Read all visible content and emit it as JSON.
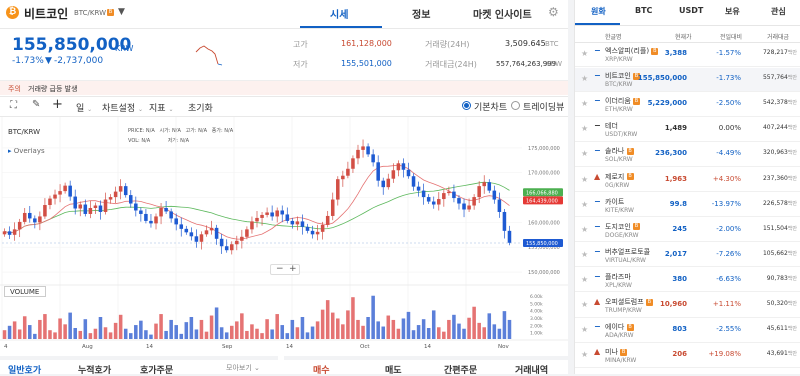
{
  "header": {
    "coin_name": "비트코인",
    "coin_pair": "BTC/KRW",
    "badge": "B",
    "tabs": [
      "시세",
      "정보",
      "마켓 인사이트"
    ],
    "active_tab": "시세"
  },
  "price": {
    "current": "155,850,000",
    "unit": "KRW",
    "change_pct": "-1.73%",
    "change_arrow": "▼",
    "change_amount": "-2,737,000",
    "high_label": "고가",
    "high": "161,128,000",
    "low_label": "저가",
    "low": "155,501,000",
    "vol_label": "거래량(24H)",
    "vol": "3,509.645",
    "vol_unit": "BTC",
    "amount_label": "거래대금(24H)",
    "amount": "557,764,263,999",
    "amount_unit": "KRW"
  },
  "notice": {
    "tag": "주의",
    "text": "거래량 급등 발생"
  },
  "toolbar": {
    "interval": "일",
    "chart_settings": "차트설정",
    "indicator": "지표",
    "reset": "초기화",
    "basic_chart": "기본차트",
    "tradingview": "트레이딩뷰"
  },
  "chart_info": {
    "pair": "BTC/KRW",
    "overlays": "Overlays",
    "price_label": "PRICE:",
    "price_val": "N/A",
    "open_label": "시가:",
    "open_val": "N/A",
    "high_label": "고가:",
    "high_val": "N/A",
    "low_label": "저가:",
    "low_val": "N/A",
    "close_label": "종가:",
    "close_val": "N/A",
    "vol_label": "VOL:",
    "vol_val": "N/A",
    "volume_title": "VOLUME",
    "zoom_out": "−",
    "zoom_in": "+"
  },
  "chart_data": {
    "type": "candlestick",
    "y_ticks": [
      "175,000,000",
      "170,000,000",
      "165,000,000",
      "160,000,000",
      "155,000,000",
      "150,000,000"
    ],
    "ylim": [
      148000000,
      178000000
    ],
    "x_ticks": [
      "4",
      "Aug",
      "14",
      "Sep",
      "14",
      "Oct",
      "14",
      "Nov"
    ],
    "price_tags": {
      "green": "166,066,880",
      "red": "164,439,000",
      "blue": "155,850,000"
    },
    "volume_ticks": [
      "6.00k",
      "5.00k",
      "4.00k",
      "3.00k",
      "2.00k",
      "1.00k"
    ],
    "closes": [
      158.2,
      157.5,
      158.6,
      160.1,
      161.9,
      160.8,
      160.0,
      161.2,
      163.5,
      164.8,
      165.6,
      166.3,
      167.4,
      165.2,
      162.8,
      163.6,
      161.7,
      162.9,
      163.4,
      162.1,
      164.6,
      165.1,
      166.2,
      167.3,
      165.5,
      163.8,
      162.4,
      161.7,
      160.3,
      159.8,
      161.2,
      162.9,
      162.2,
      160.8,
      159.6,
      158.7,
      158.0,
      157.2,
      156.1,
      157.6,
      158.4,
      158.9,
      156.7,
      155.2,
      154.4,
      155.6,
      156.3,
      157.1,
      158.6,
      160.2,
      160.9,
      161.5,
      162.0,
      161.2,
      162.4,
      161.6,
      160.3,
      159.6,
      160.2,
      159.1,
      158.3,
      157.6,
      158.1,
      159.5,
      161.3,
      164.6,
      168.7,
      169.4,
      170.8,
      172.9,
      174.6,
      175.3,
      173.7,
      172.1,
      168.4,
      167.1,
      168.8,
      170.5,
      171.9,
      170.6,
      169.3,
      167.2,
      166.4,
      165.1,
      164.2,
      163.6,
      164.7,
      165.9,
      166.2,
      164.9,
      163.8,
      162.6,
      163.4,
      165.1,
      167.3,
      168.1,
      166.4,
      164.6,
      162.1,
      158.3,
      155.9
    ],
    "volumes": [
      1.2,
      1.8,
      2.4,
      1.3,
      3.1,
      1.9,
      0.7,
      2.6,
      3.4,
      1.2,
      0.9,
      2.8,
      2.0,
      3.6,
      1.5,
      1.1,
      2.7,
      0.8,
      1.4,
      3.0,
      1.6,
      0.9,
      2.2,
      3.3,
      1.4,
      0.8,
      1.9,
      2.5,
      1.2,
      0.6,
      2.1,
      3.4,
      1.1,
      2.6,
      1.9,
      0.7,
      2.3,
      3.0,
      1.3,
      2.6,
      1.0,
      3.2,
      4.3,
      1.6,
      0.9,
      1.8,
      2.4,
      3.5,
      1.1,
      2.0,
      1.4,
      0.8,
      2.7,
      1.3,
      3.4,
      1.9,
      0.8,
      2.6,
      1.6,
      3.0,
      0.9,
      1.7,
      2.4,
      4.0,
      5.3,
      3.6,
      2.8,
      2.0,
      3.9,
      5.7,
      2.6,
      1.8,
      3.0,
      5.9,
      2.4,
      1.7,
      3.2,
      2.6,
      1.4,
      2.8,
      3.7,
      1.2,
      1.9,
      2.7,
      1.5,
      3.9,
      1.6,
      1.0,
      2.6,
      3.3,
      2.1,
      1.4,
      2.9,
      4.4,
      2.2,
      1.6,
      3.5,
      2.0,
      1.4,
      3.8,
      2.6
    ]
  },
  "right_panel": {
    "tabs": [
      "원화",
      "BTC",
      "USDT",
      "보유",
      "관심"
    ],
    "active_tab": "원화",
    "col_name": "한글명",
    "col_price": "현재가",
    "col_change": "전일대비",
    "col_volume": "거래대금",
    "coins": [
      {
        "name": "엑스알피(리플)",
        "sym": "XRP/KRW",
        "price": "3,388",
        "change": "-1.57%",
        "vol": "728,217",
        "unit": "백만",
        "dir": "down",
        "badge": "orange"
      },
      {
        "name": "비트코인",
        "sym": "BTC/KRW",
        "price": "155,850,000",
        "change": "-1.73%",
        "vol": "557,764",
        "unit": "백만",
        "dir": "down",
        "badge": "orange"
      },
      {
        "name": "이더리움",
        "sym": "ETH/KRW",
        "price": "5,229,000",
        "change": "-2.50%",
        "vol": "542,378",
        "unit": "백만",
        "dir": "down",
        "badge": "orange"
      },
      {
        "name": "테더",
        "sym": "USDT/KRW",
        "price": "1,489",
        "change": "0.00%",
        "vol": "407,244",
        "unit": "백만",
        "dir": "flat",
        "badge": ""
      },
      {
        "name": "솔라나",
        "sym": "SOL/KRW",
        "price": "236,300",
        "change": "-4.49%",
        "vol": "320,963",
        "unit": "백만",
        "dir": "down",
        "badge": "orange"
      },
      {
        "name": "제로지",
        "sym": "0G/KRW",
        "price": "1,963",
        "change": "+4.30%",
        "vol": "237,360",
        "unit": "백만",
        "dir": "up",
        "badge": "orange"
      },
      {
        "name": "카이트",
        "sym": "KITE/KRW",
        "price": "99.8",
        "change": "-13.97%",
        "vol": "226,578",
        "unit": "백만",
        "dir": "down",
        "badge": ""
      },
      {
        "name": "도지코인",
        "sym": "DOGE/KRW",
        "price": "245",
        "change": "-2.00%",
        "vol": "151,504",
        "unit": "백만",
        "dir": "down",
        "badge": "orange"
      },
      {
        "name": "버추얼프로토콜",
        "sym": "VIRTUAL/KRW",
        "price": "2,017",
        "change": "-7.26%",
        "vol": "105,662",
        "unit": "백만",
        "dir": "down",
        "badge": ""
      },
      {
        "name": "플라즈마",
        "sym": "XPL/KRW",
        "price": "380",
        "change": "-6.63%",
        "vol": "90,783",
        "unit": "백만",
        "dir": "down",
        "badge": ""
      },
      {
        "name": "오피셜트럼프",
        "sym": "TRUMP/KRW",
        "price": "10,960",
        "change": "+1.11%",
        "vol": "50,320",
        "unit": "백만",
        "dir": "up",
        "badge": "orange"
      },
      {
        "name": "에이다",
        "sym": "ADA/KRW",
        "price": "803",
        "change": "-2.55%",
        "vol": "45,611",
        "unit": "백만",
        "dir": "down",
        "badge": "orange"
      },
      {
        "name": "미나",
        "sym": "MINA/KRW",
        "price": "206",
        "change": "+19.08%",
        "vol": "43,691",
        "unit": "백만",
        "dir": "up",
        "badge": "orange"
      }
    ]
  },
  "bottom": {
    "left_tabs": [
      "일반호가",
      "누적호가",
      "호가주문"
    ],
    "dropdown": "모아보기",
    "order_tabs": [
      "매수",
      "매도",
      "간편주문",
      "거래내역"
    ]
  }
}
